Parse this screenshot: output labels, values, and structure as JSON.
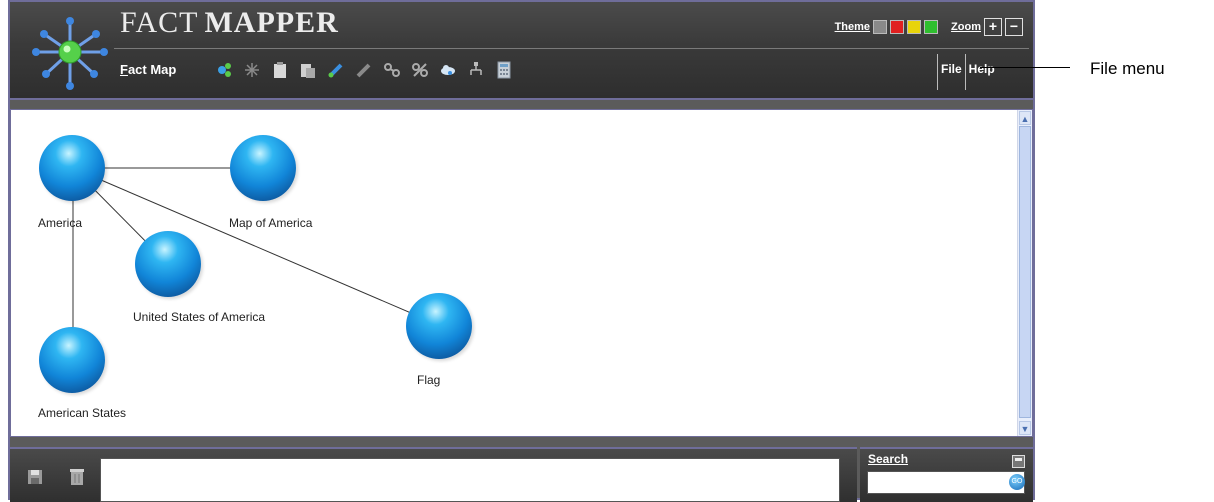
{
  "app": {
    "brand_fact": "FACT",
    "brand_mapper": "MAPPER"
  },
  "header": {
    "mode_first": "F",
    "mode_rest": "act Map",
    "theme_label": "Theme",
    "zoom_label": "Zoom",
    "zoom_in": "+",
    "zoom_out": "−",
    "theme_colors": [
      "#8a8a8a",
      "#e02020",
      "#e8d40a",
      "#2fbf2f"
    ],
    "menus": [
      "File",
      "Help"
    ]
  },
  "toolbar": {
    "tools": [
      "add-node-icon",
      "sparkle-icon",
      "clipboard-icon",
      "paste-icon",
      "edit-pen-icon",
      "pen-disabled-icon",
      "link-icon",
      "unlink-icon",
      "cloud-icon",
      "tree-icon",
      "calculator-icon"
    ]
  },
  "map": {
    "nodes": [
      {
        "id": "america",
        "label": "America"
      },
      {
        "id": "map_of_america",
        "label": "Map of America"
      },
      {
        "id": "usa",
        "label": "United States of America"
      },
      {
        "id": "flag",
        "label": "Flag"
      },
      {
        "id": "american_states",
        "label": "American States"
      }
    ]
  },
  "search": {
    "label": "Search",
    "value": ""
  },
  "notes": {
    "value": ""
  },
  "callout": {
    "text": "File menu"
  }
}
